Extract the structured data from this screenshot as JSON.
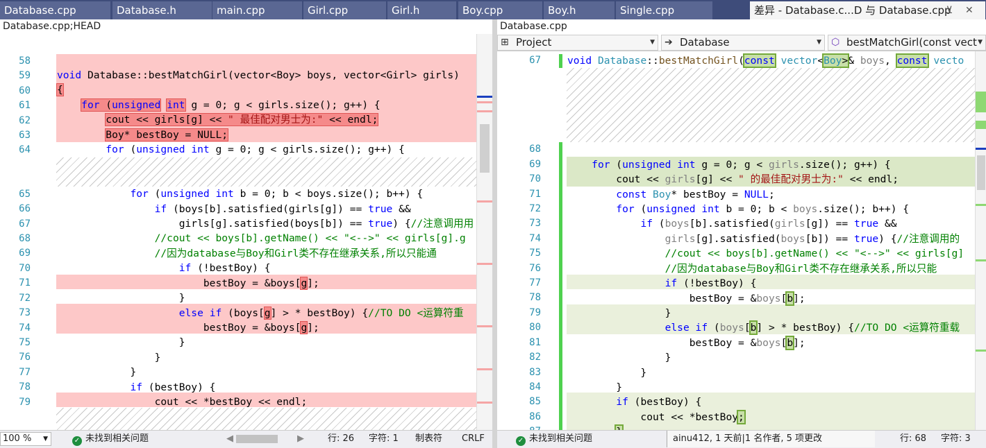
{
  "tabs": [
    {
      "label": "Database.cpp"
    },
    {
      "label": "Database.h"
    },
    {
      "label": "main.cpp"
    },
    {
      "label": "Girl.cpp"
    },
    {
      "label": "Girl.h"
    },
    {
      "label": "Boy.cpp"
    },
    {
      "label": "Boy.h"
    },
    {
      "label": "Single.cpp"
    },
    {
      "label": "差异 - Database.c...D 与 Database.cpp"
    }
  ],
  "tab_controls": {
    "pin": "⊻",
    "close": "✕"
  },
  "left": {
    "path": "Database.cpp;HEAD",
    "line_numbers": [
      "58",
      "59",
      "60",
      "61",
      "62",
      "63",
      "64",
      "65",
      "66",
      "67",
      "68",
      "69",
      "70",
      "71",
      "72",
      "73",
      "74",
      "75",
      "76",
      "77",
      "78",
      "79"
    ],
    "status": {
      "zoom": "100 %",
      "issues": "未找到相关问题",
      "line": "行: 26",
      "col": "字符: 1",
      "tabs": "制表符",
      "eol": "CRLF"
    }
  },
  "right": {
    "path": "Database.cpp",
    "nav": {
      "project": "Project",
      "class": "Database",
      "member": "bestMatchGirl(const vect"
    },
    "line_numbers": [
      "67",
      "68",
      "69",
      "70",
      "71",
      "72",
      "73",
      "74",
      "75",
      "76",
      "77",
      "78",
      "79",
      "80",
      "81",
      "82",
      "83",
      "84",
      "85",
      "86",
      "87"
    ],
    "status": {
      "issues": "未找到相关问题",
      "author": "ainu412, 1 天前|1 名作者, 5 项更改",
      "line": "行: 68",
      "col": "字符: 3"
    }
  },
  "icons": {
    "check": "check-icon",
    "arrow": "arrow-right-icon",
    "cube": "cube-icon",
    "dropdown": "chevron-down-icon"
  }
}
